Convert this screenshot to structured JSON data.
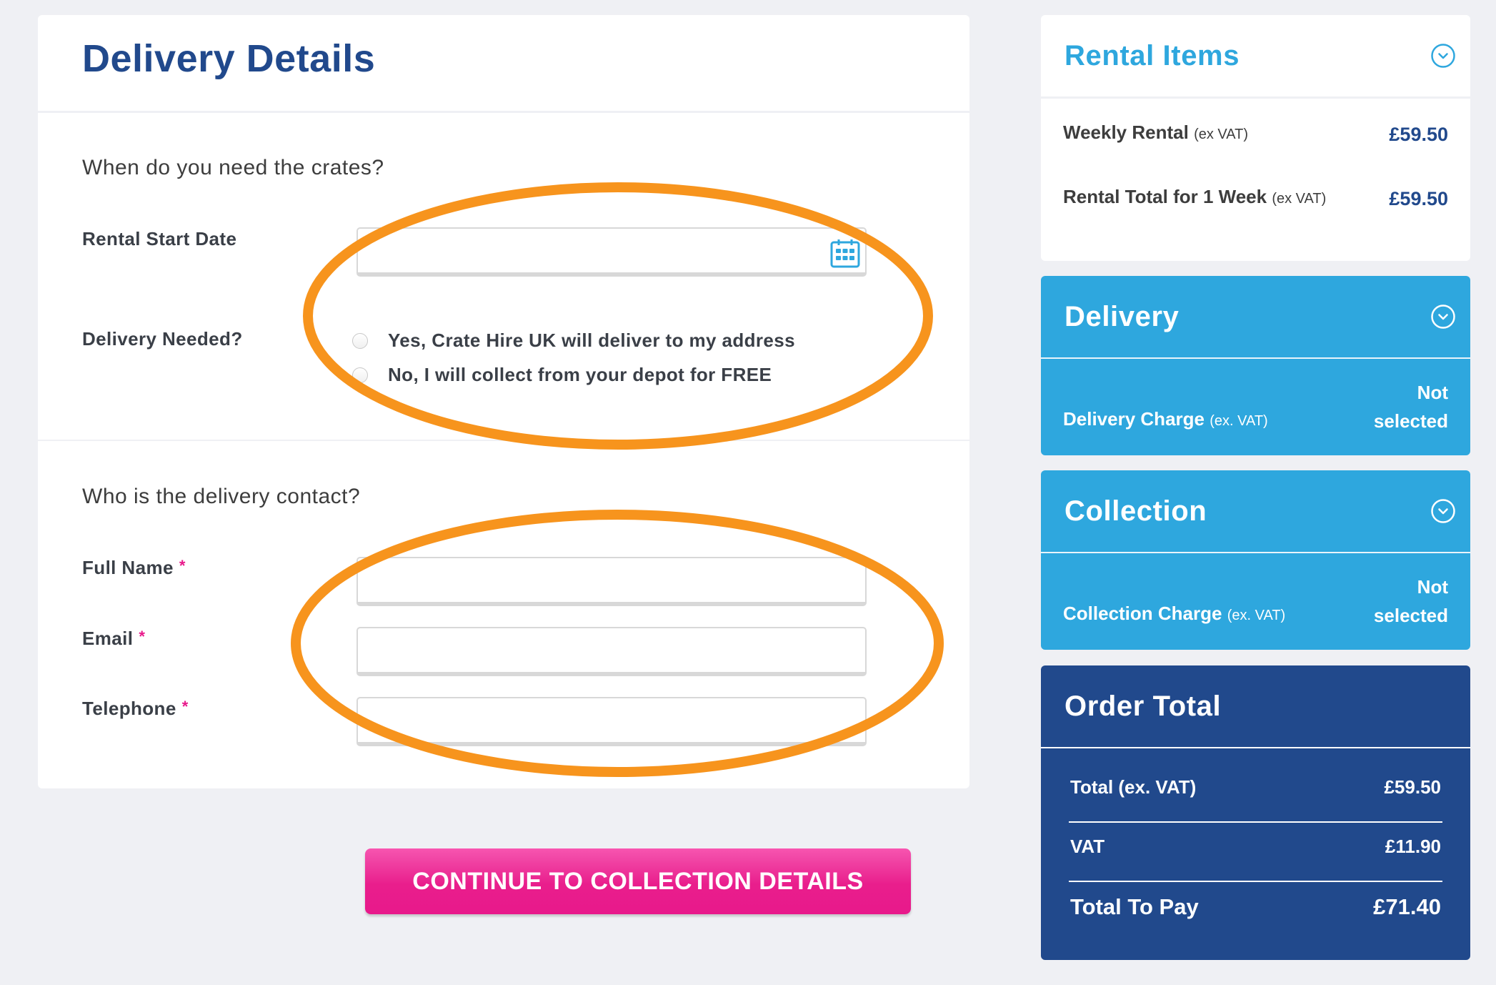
{
  "main": {
    "title": "Delivery Details",
    "when_section": {
      "question": "When do you need the crates?",
      "rental_start_date": {
        "label": "Rental Start Date",
        "value": "",
        "icon": "calendar-icon"
      },
      "delivery_needed": {
        "label": "Delivery Needed?",
        "options": [
          {
            "label": "Yes, Crate Hire UK will deliver to my address",
            "selected": false
          },
          {
            "label": "No, I will collect from your depot for FREE",
            "selected": false
          }
        ]
      }
    },
    "contact_section": {
      "question": "Who is the delivery contact?",
      "required_marker": "*",
      "fields": [
        {
          "label": "Full Name",
          "value": "",
          "required": true
        },
        {
          "label": "Email",
          "value": "",
          "required": true
        },
        {
          "label": "Telephone",
          "value": "",
          "required": true
        }
      ]
    },
    "continue_button": "CONTINUE TO COLLECTION DETAILS"
  },
  "sidebar": {
    "rental_items": {
      "title": "Rental Items",
      "lines": [
        {
          "label": "Weekly Rental",
          "note": "(ex VAT)",
          "price": "£59.50"
        },
        {
          "label": "Rental Total for 1 Week",
          "note": "(ex VAT)",
          "price": "£59.50"
        }
      ]
    },
    "delivery": {
      "title": "Delivery",
      "charge_label": "Delivery Charge",
      "charge_note": "(ex. VAT)",
      "charge_value_line1": "Not",
      "charge_value_line2": "selected"
    },
    "collection": {
      "title": "Collection",
      "charge_label": "Collection Charge",
      "charge_note": "(ex. VAT)",
      "charge_value_line1": "Not",
      "charge_value_line2": "selected"
    },
    "order_total": {
      "title": "Order Total",
      "rows": [
        {
          "label": "Total (ex. VAT)",
          "value": "£59.50"
        },
        {
          "label": "VAT",
          "value": "£11.90"
        },
        {
          "label": "Total To Pay",
          "value": "£71.40"
        }
      ]
    }
  },
  "colors": {
    "brand_navy": "#21498c",
    "brand_blue": "#2ea7de",
    "button_pink": "#e8198b",
    "annotation_orange": "#f7941d",
    "background": "#eff0f4"
  }
}
